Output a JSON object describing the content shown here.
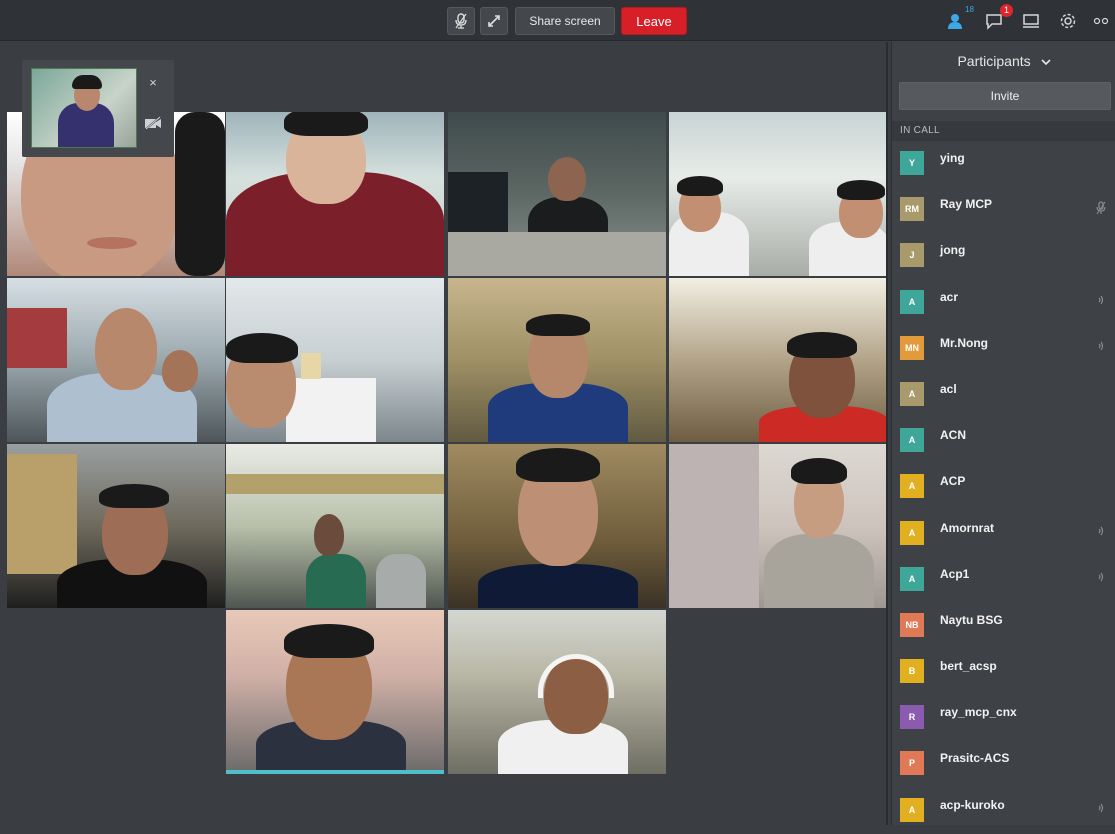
{
  "toolbar": {
    "mic_icon": "microphone-icon",
    "fullscreen_icon": "expand-icon",
    "share_label": "Share screen",
    "leave_label": "Leave",
    "participants_badge": "18",
    "chat_badge": "1",
    "colors": {
      "leave": "#d61f26",
      "bar": "#2f3236",
      "accent": "#3ea7e8"
    }
  },
  "self_view": {
    "close_label": "×"
  },
  "sidebar": {
    "title": "Participants",
    "invite_label": "Invite",
    "section_label": "IN CALL",
    "participants": [
      {
        "initials": "Y",
        "name": "ying",
        "color": "#3fa69a",
        "status": ""
      },
      {
        "initials": "RM",
        "name": "Ray MCP",
        "color": "#a89a6a",
        "status": "mic-icon"
      },
      {
        "initials": "J",
        "name": "jong",
        "color": "#a89a6a",
        "status": ""
      },
      {
        "initials": "A",
        "name": "acr",
        "color": "#3fa69a",
        "status": "speaker-icon"
      },
      {
        "initials": "MN",
        "name": "Mr.Nong",
        "color": "#e39a3a",
        "status": "speaker-icon"
      },
      {
        "initials": "A",
        "name": "acl",
        "color": "#a89a6a",
        "status": ""
      },
      {
        "initials": "A",
        "name": "ACN",
        "color": "#3fa69a",
        "status": ""
      },
      {
        "initials": "A",
        "name": "ACP",
        "color": "#e0b020",
        "status": ""
      },
      {
        "initials": "A",
        "name": "Amornrat",
        "color": "#e0b020",
        "status": "speaker-icon"
      },
      {
        "initials": "A",
        "name": "Acp1",
        "color": "#3fa69a",
        "status": "speaker-icon"
      },
      {
        "initials": "NB",
        "name": "Naytu BSG",
        "color": "#e07a56",
        "status": ""
      },
      {
        "initials": "B",
        "name": "bert_acsp",
        "color": "#e0b020",
        "status": ""
      },
      {
        "initials": "R",
        "name": "ray_mcp_cnx",
        "color": "#8b5bb0",
        "status": ""
      },
      {
        "initials": "P",
        "name": "Prasitc-ACS",
        "color": "#e07a56",
        "status": ""
      },
      {
        "initials": "A",
        "name": "acp-kuroko",
        "color": "#e0b020",
        "status": "speaker-icon"
      }
    ]
  }
}
